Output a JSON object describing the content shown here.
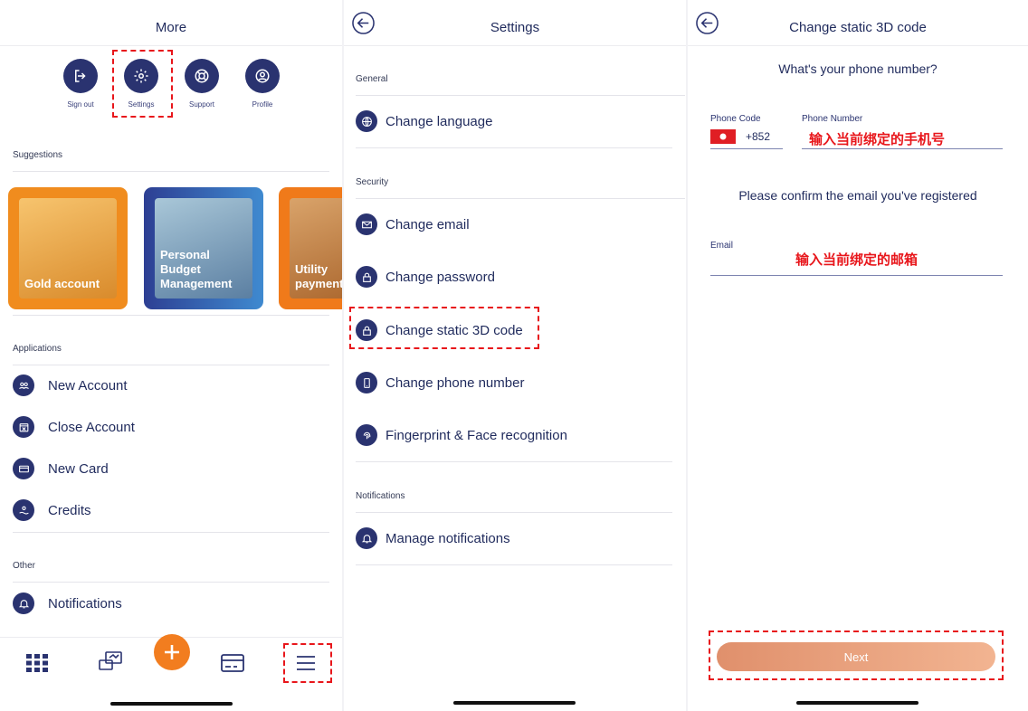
{
  "panel1": {
    "title": "More",
    "quick_actions": [
      {
        "label": "Sign out",
        "icon": "sign-out-icon"
      },
      {
        "label": "Settings",
        "icon": "gear-icon"
      },
      {
        "label": "Support",
        "icon": "lifebuoy-icon"
      },
      {
        "label": "Profile",
        "icon": "user-icon"
      }
    ],
    "suggestions_title": "Suggestions",
    "suggestions": [
      {
        "label": "Gold account",
        "color": "#f08c1e"
      },
      {
        "label": "Personal Budget Management",
        "color": "#2f5aa8"
      },
      {
        "label": "Utility payment",
        "color": "#f07a1a"
      }
    ],
    "applications_title": "Applications",
    "applications": [
      {
        "label": "New Account",
        "icon": "users-icon"
      },
      {
        "label": "Close Account",
        "icon": "calendar-x-icon"
      },
      {
        "label": "New Card",
        "icon": "card-icon"
      },
      {
        "label": "Credits",
        "icon": "hand-coin-icon"
      }
    ],
    "other_title": "Other",
    "other": [
      {
        "label": "Notifications",
        "icon": "bell-icon"
      }
    ],
    "bottom_nav": [
      "grid-icon",
      "transfer-icon",
      "plus-icon",
      "card-icon",
      "menu-icon"
    ]
  },
  "panel2": {
    "title": "Settings",
    "general_title": "General",
    "general": [
      {
        "label": "Change language",
        "icon": "globe-icon"
      }
    ],
    "security_title": "Security",
    "security": [
      {
        "label": "Change email",
        "icon": "envelope-icon"
      },
      {
        "label": "Change password",
        "icon": "lock-icon"
      },
      {
        "label": "Change static 3D code",
        "icon": "lock-icon"
      },
      {
        "label": "Change phone number",
        "icon": "phone-icon"
      },
      {
        "label": "Fingerprint & Face recognition",
        "icon": "fingerprint-icon"
      }
    ],
    "notifications_title": "Notifications",
    "notifications": [
      {
        "label": "Manage notifications",
        "icon": "bell-icon"
      }
    ]
  },
  "panel3": {
    "title": "Change static 3D code",
    "phone_question": "What's your phone number?",
    "phone_code_label": "Phone Code",
    "phone_code_value": "+852",
    "phone_number_label": "Phone Number",
    "phone_number_hint": "输入当前绑定的手机号",
    "email_prompt": "Please confirm the email you've registered",
    "email_label": "Email",
    "email_hint": "输入当前绑定的邮箱",
    "next_label": "Next",
    "next_color": "#eba17e"
  },
  "colors": {
    "navy": "#2a3370",
    "accent_orange": "#f27d1f",
    "highlight_red": "#e8161b"
  }
}
